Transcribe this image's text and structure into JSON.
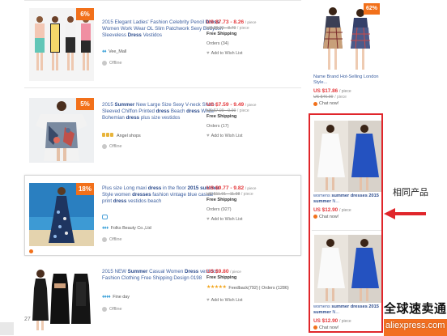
{
  "items": [
    {
      "badge": "6%",
      "title_parts": [
        "2015 Elegant Ladies' Fashion Celebrity Pencil ",
        "Dress",
        " Women Work Wear OL Slim Patchwork Sexy Bodycon Sleeveless ",
        "Dress",
        " Vestidos"
      ],
      "store": "Vee_Mall",
      "offline": "Offline",
      "price": "US $7.73 - 8.26",
      "price_unit": "/ piece",
      "old_price": "US $8.22 - 8.79",
      "old_unit": "/ piece",
      "shipping": "Free Shipping",
      "orders": "Orders (34)",
      "wishlist": "Add to Wish List"
    },
    {
      "badge": "5%",
      "title_parts": [
        "2015 ",
        "Summer",
        " New Large Size Sexy V-neck Short-Sleeved Chiffon Printed ",
        "dress",
        " Beach ",
        "dress",
        " White Bohemian ",
        "dress",
        " plus size vestidos"
      ],
      "store": "Angel shops",
      "offline": "Offline",
      "price": "US $7.59 - 9.49",
      "price_unit": "/ piece",
      "old_price": "US $7.99 - 9.99",
      "old_unit": "/ piece",
      "shipping": "Free Shipping",
      "orders": "Orders (17)",
      "wishlist": "Add to Wish List"
    },
    {
      "badge": "18%",
      "title_parts": [
        "Plus size Long maxi ",
        "dress",
        " in the floor ",
        "2015 summer",
        " Style women ",
        "dresses",
        " fashion vintage blue casual print ",
        "dress",
        " vestidos beach"
      ],
      "store": "Folks Beauty Co.,Ltd",
      "offline": "Offline",
      "price": "US $9.77 - 9.82",
      "price_unit": "/ piece",
      "old_price": "US $11.91 - 11.98",
      "old_unit": "/ piece",
      "shipping": "Free Shipping",
      "orders": "Orders (927)",
      "wishlist": "Add to Wish List"
    },
    {
      "title_parts": [
        "2015 NEW ",
        "Summer",
        " Casual Women ",
        "Dress",
        " vestidos Fashion Clothing Free Shipping Design 0198"
      ],
      "store": "Fine day",
      "offline": "Offline",
      "price": "US $9.80",
      "price_unit": "/ piece",
      "shipping": "Free Shipping",
      "rating_stars": "★★★★★",
      "feedback": "Feedback(792) | Orders (1286)",
      "wishlist": "Add to Wish List"
    }
  ],
  "right": [
    {
      "badge": "62%",
      "title_parts": [
        "Name Brand Hot-Selling London Style..."
      ],
      "price": "US $17.86",
      "price_unit": "/ piece",
      "old_price": "US $46.99",
      "old_unit": "/ piece",
      "chat": "Chat now!"
    },
    {
      "title_parts": [
        "womens ",
        "summer dresses 2015",
        " ",
        "summer",
        " N..."
      ],
      "price": "US $12.90",
      "price_unit": "/ piece",
      "chat": "Chat now!"
    },
    {
      "title_parts": [
        "womens ",
        "summer dresses 2015 summer",
        " N..."
      ],
      "price": "US $12.90",
      "price_unit": "/ piece",
      "chat": "Chat now!"
    }
  ],
  "annotation": "相同产品",
  "watermark_cn": "全球速卖通",
  "watermark_en": "aliexpress.com",
  "page_number": "27"
}
